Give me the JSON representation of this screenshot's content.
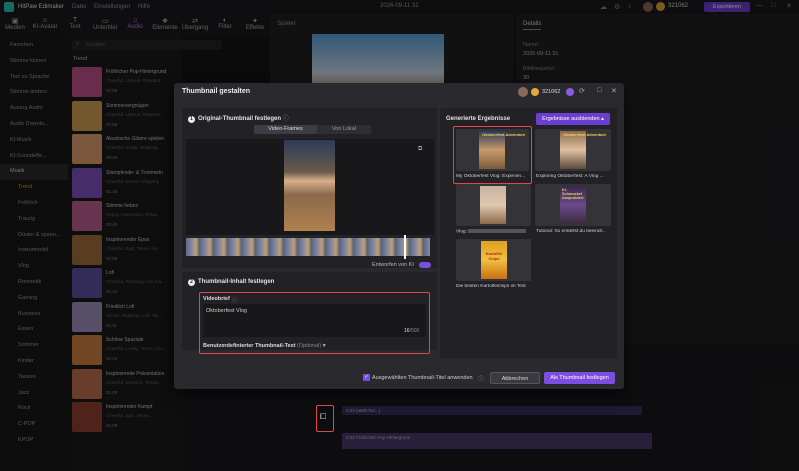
{
  "app": {
    "name": "HitPaw Edimaker",
    "menus": [
      "Datei",
      "Einstellungen",
      "Hilfe"
    ],
    "doc_title": "2026-09-11 31",
    "export_label": "Exportieren",
    "credits": "321062"
  },
  "toolbar": [
    "Medien",
    "KI-Avatar",
    "Text",
    "Untertitel",
    "Audio",
    "Elemente",
    "Übergang",
    "Filter",
    "Effekte"
  ],
  "sidebar": {
    "items": [
      "Favoriten",
      "Stimme klonen",
      "Text zu Sprache",
      "Stimme ändern",
      "Ausrug Audio",
      "Audio Downlo...",
      "KI-Musik",
      "KI-Soundeffe...",
      "Musik",
      "Trend",
      "Fröhlich",
      "Traurig",
      "Düster & spann...",
      "Instrumentel",
      "Vlog",
      "Romantik",
      "Gaming",
      "Business",
      "Essen",
      "Sommer",
      "Kinder",
      "Tanzen",
      "Jazz",
      "Rock",
      "C-POP",
      "KPOP"
    ]
  },
  "content": {
    "search_placeholder": "Suchen",
    "section": "Trend",
    "tracks": [
      {
        "title": "Fröhlicher Pop-Hintergrund",
        "desc": "Cheerful, Upbeat, Pleasant",
        "dur": "01:00"
      },
      {
        "title": "Sommervergnügen",
        "desc": "Cheerful, Upbeat, Pleasure...",
        "dur": "01:58"
      },
      {
        "title": "Akustische Gitarre spielen",
        "desc": "Cheerful, Guitar, Relaxing...",
        "dur": "00:40"
      },
      {
        "title": "Stampfende- & Trommeln",
        "desc": "Cheerful, Drums, Clapping",
        "dur": "01:46"
      },
      {
        "title": "Stimme heben",
        "desc": "Happy, Harmonica, Relax...",
        "dur": "02:40"
      },
      {
        "title": "Inspirierender Epos",
        "desc": "Cheerful, Epic, Tense, Ins...",
        "dur": "01:00"
      },
      {
        "title": "Lofi",
        "desc": "Cheerful, Relaxing, Lofi, Ca...",
        "dur": "01:34"
      },
      {
        "title": "Friedlich Lofi",
        "desc": "Tender, Relaxing, Lofi, Hip...",
        "dur": "01:11"
      },
      {
        "title": "Schöne Spaziale",
        "desc": "Cheerful, Lovely, Tense, Ins...",
        "dur": "01:04"
      },
      {
        "title": "Inspirierende Präsentation",
        "desc": "Cheerful, Dynamic, Relaxi...",
        "dur": "01:00"
      },
      {
        "title": "Inspirierender Kampf",
        "desc": "Cheerful, Epic, Tense...",
        "dur": "01:00"
      }
    ]
  },
  "player": {
    "label": "Spieler"
  },
  "details": {
    "tab": "Details",
    "name_label": "Name:",
    "name_value": "2026-09-11 31",
    "fps_label": "Bildfrequenz:",
    "fps_value": "30"
  },
  "modal": {
    "title": "Thumbnail gestalten",
    "credits": "321062",
    "section1_title": "Original-Thumbnail festlegen",
    "tab_frames": "Video-Frames",
    "tab_local": "Von Lokal",
    "designed_by_ai": "Entworfen von KI",
    "section2_title": "Thumbnail-Inhalt festlegen",
    "brief_label": "Videobrief",
    "brief_value": "Oktoberfest Vlog",
    "char_count": "16",
    "char_max": "/500",
    "custom_text_label": "Benutzerdefinierter Thumbnail-Text",
    "custom_text_optional": "(Optional)",
    "results_title": "Generierte Ergebnisse",
    "hide_results": "Ergebnisse ausblenden",
    "results": [
      {
        "caption": "My Oktoberfest Vlog: Experien...",
        "overlay": "Oktoberfest Adventure"
      },
      {
        "caption": "Exploring Oktoberfest: A Vlog ...",
        "overlay": "Oktoberfest Adventure"
      },
      {
        "caption": "Vlog: ",
        "overlay": ""
      },
      {
        "caption": "Tutorial: So erstellst du beeindr...",
        "overlay": "KI-Schmuckel Ausprobiert"
      },
      {
        "caption": "Die besten Kartoffelchips im Test",
        "overlay": "Kartoffel Chips"
      }
    ],
    "apply_title_label": "Ausgewählten Thumbnail-Titel anwenden",
    "cancel_label": "Abbrechen",
    "confirm_label": "Als Thumbnail festlegen"
  },
  "timeline": {
    "clip_label": "0:03 (a88h752...)",
    "audio_label": "0:02 Fröhlicher Pop-Hintergrund"
  },
  "colors": {
    "accent": "#7b4de0",
    "highlight_red": "#e04848",
    "bg": "#141416"
  }
}
